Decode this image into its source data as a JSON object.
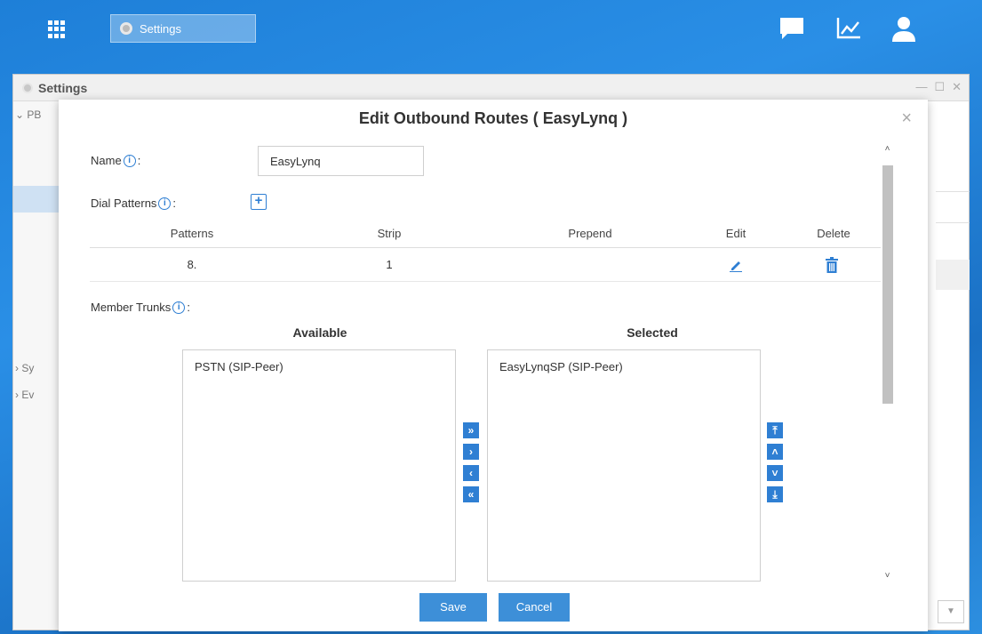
{
  "taskbar": {
    "tab_label": "Settings",
    "icons": [
      "chat-icon",
      "chart-icon",
      "user-icon"
    ]
  },
  "background_window": {
    "title": "Settings",
    "controls": [
      "—",
      "☐",
      "✕"
    ],
    "tree": [
      "PB",
      "Sy",
      "Ev"
    ]
  },
  "modal": {
    "title": "Edit Outbound Routes ( EasyLynq )",
    "close": "×",
    "name_label": "Name",
    "name_value": "EasyLynq",
    "dial_patterns_label": "Dial Patterns",
    "add_symbol": "+",
    "info_symbol": "i",
    "table": {
      "headers": [
        "Patterns",
        "Strip",
        "Prepend",
        "Edit",
        "Delete"
      ],
      "rows": [
        {
          "pattern": "8.",
          "strip": "1",
          "prepend": ""
        }
      ]
    },
    "member_trunks_label": "Member Trunks",
    "available_title": "Available",
    "selected_title": "Selected",
    "available": [
      "PSTN (SIP-Peer)"
    ],
    "selected": [
      "EasyLynqSP (SIP-Peer)"
    ],
    "move_buttons": [
      "»",
      "›",
      "‹",
      "«"
    ],
    "order_buttons": [
      "⤒",
      "˄",
      "˅",
      "⤓"
    ],
    "save": "Save",
    "cancel": "Cancel",
    "colors": {
      "accent": "#3d8fd8",
      "taskbar": "#1e7fd8"
    }
  }
}
